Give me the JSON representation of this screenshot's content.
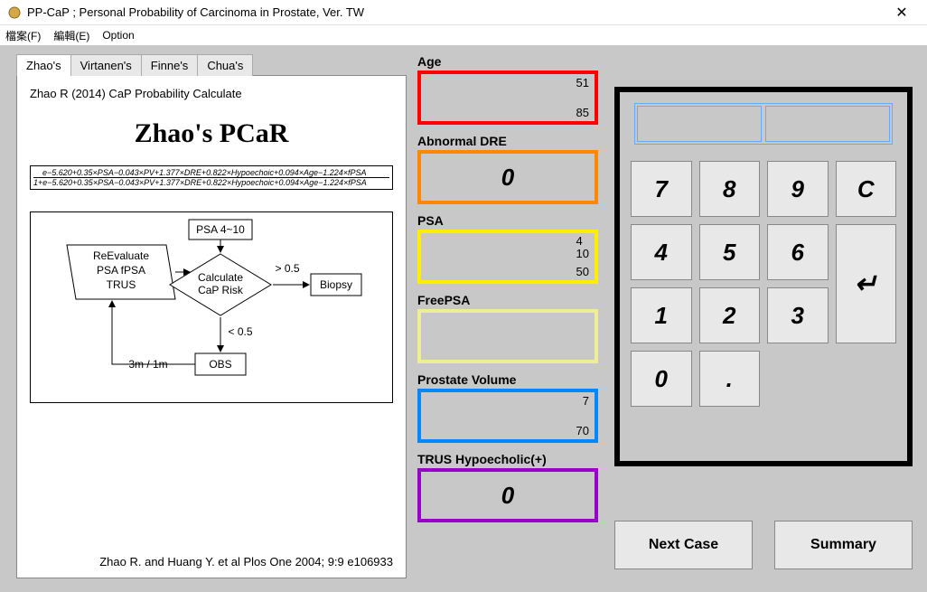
{
  "window": {
    "title": "PP-CaP ; Personal Probability of Carcinoma in Prostate, Ver. TW"
  },
  "menu": {
    "file": "檔案(F)",
    "edit": "編輯(E)",
    "option": "Option"
  },
  "tabs": [
    "Zhao's",
    "Virtanen's",
    "Finne's",
    "Chua's"
  ],
  "panel": {
    "ref": "Zhao R (2014) CaP Probability Calculate",
    "title": "Zhao's PCaR",
    "formula_num": "e−5.620+0.35×PSA−0.043×PV+1.377×DRE+0.822×Hypoechoic+0.094×Age−1.224×fPSA",
    "formula_den": "1+e−5.620+0.35×PSA−0.043×PV+1.377×DRE+0.822×Hypoechoic+0.094×Age−1.224×fPSA",
    "citation": "Zhao R.  and Huang Y. et al   Plos One 2004; 9:9 e106933"
  },
  "flow": {
    "psa_range": "PSA 4~10",
    "reeval_l1": "ReEvaluate",
    "reeval_l2": "PSA  fPSA",
    "reeval_l3": "TRUS",
    "calc_l1": "Calculate",
    "calc_l2": "CaP Risk",
    "gt": "> 0.5",
    "lt": "< 0.5",
    "biopsy": "Biopsy",
    "obs": "OBS",
    "interval": "3m / 1m"
  },
  "fields": {
    "age": {
      "label": "Age",
      "top": "51",
      "bot": "85",
      "border": "#ff0000"
    },
    "dre": {
      "label": "Abnormal DRE",
      "center": "0",
      "border": "#ff8800"
    },
    "psa": {
      "label": "PSA",
      "top": "4\n10",
      "bot": "50",
      "border": "#ffee00"
    },
    "fpsa": {
      "label": "FreePSA",
      "top": "",
      "bot": "",
      "border": "#eeee99"
    },
    "pv": {
      "label": "Prostate Volume",
      "top": "7",
      "bot": "70",
      "border": "#0088ff"
    },
    "trus": {
      "label": "TRUS Hypoecholic(+)",
      "center": "0",
      "border": "#9900cc"
    }
  },
  "keypad": {
    "k7": "7",
    "k8": "8",
    "k9": "9",
    "kc": "C",
    "k4": "4",
    "k5": "5",
    "k6": "6",
    "k1": "1",
    "k2": "2",
    "k3": "3",
    "kenter": "↵",
    "k0": "0",
    "kdot": "."
  },
  "buttons": {
    "next": "Next Case",
    "summary": "Summary"
  }
}
